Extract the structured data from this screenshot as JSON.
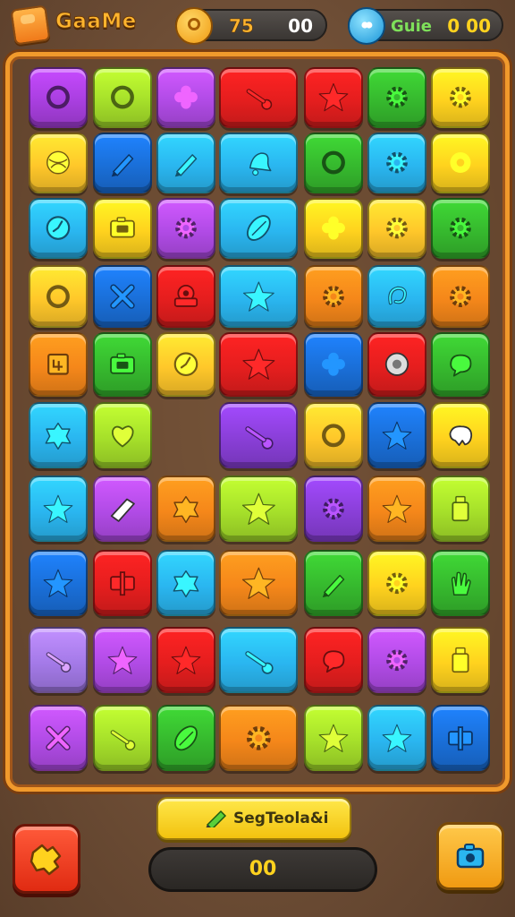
{
  "header": {
    "title": "GaaMe",
    "coin_value": "75",
    "coin_extra": "00",
    "gem_label": "Guie",
    "gem_value": "0 00"
  },
  "board": {
    "rows": [
      [
        {
          "c": "#a93fe0",
          "i": "ring"
        },
        {
          "c": "#a6e02a",
          "i": "ring"
        },
        {
          "c": "#b14be6",
          "i": "flower"
        },
        {
          "c": "#e51e1e",
          "i": "key",
          "w": 2
        },
        {
          "c": "#e51e1e",
          "i": "star"
        },
        {
          "c": "#36b92e",
          "i": "gear"
        },
        {
          "c": "#ffd21e",
          "i": "gear"
        }
      ],
      [
        {
          "c": "#ffc72a",
          "i": "ball"
        },
        {
          "c": "#1a6fd8",
          "i": "pencil"
        },
        {
          "c": "#2ab6f0",
          "i": "pencil"
        },
        {
          "c": "#2ab6f0",
          "i": "bell",
          "w": 2
        },
        {
          "c": "#36b92e",
          "i": "ring"
        },
        {
          "c": "#2ab6f0",
          "i": "gear"
        },
        {
          "c": "#ffd21e",
          "i": "donut"
        }
      ],
      [
        {
          "c": "#2ab6f0",
          "i": "clock"
        },
        {
          "c": "#ffd21e",
          "i": "camera"
        },
        {
          "c": "#b14be6",
          "i": "gear"
        },
        {
          "c": "#2ab6f0",
          "i": "leaf",
          "w": 2
        },
        {
          "c": "#ffd21e",
          "i": "flower"
        },
        {
          "c": "#ffc72a",
          "i": "gear"
        },
        {
          "c": "#36b92e",
          "i": "gear"
        }
      ],
      [
        {
          "c": "#ffc72a",
          "i": "ring"
        },
        {
          "c": "#1a6fd8",
          "i": "cross"
        },
        {
          "c": "#e51e1e",
          "i": "pot"
        },
        {
          "c": "#2ab6f0",
          "i": "star",
          "w": 2
        },
        {
          "c": "#f5871a",
          "i": "gear"
        },
        {
          "c": "#2ab6f0",
          "i": "hook"
        },
        {
          "c": "#f5871a",
          "i": "gear"
        }
      ],
      [
        {
          "c": "#f5871a",
          "i": "square"
        },
        {
          "c": "#36b92e",
          "i": "camera"
        },
        {
          "c": "#ffc72a",
          "i": "clock"
        },
        {
          "c": "#e51e1e",
          "i": "star",
          "w": 2
        },
        {
          "c": "#1a6fd8",
          "i": "flower"
        },
        {
          "c": "#e51e1e",
          "i": "disc"
        },
        {
          "c": "#36b92e",
          "i": "bubble"
        }
      ],
      [
        {
          "c": "#2ab6f0",
          "i": "blob"
        },
        {
          "c": "#a6e02a",
          "i": "heart"
        },
        {
          "c": null
        },
        {
          "c": "#8a3fd8",
          "i": "key",
          "w": 2
        },
        {
          "c": "#ffc72a",
          "i": "ring"
        },
        {
          "c": "#1a6fd8",
          "i": "star"
        },
        {
          "c": "#ffd21e",
          "i": "tooth"
        }
      ],
      [
        {
          "c": "#2ab6f0",
          "i": "star"
        },
        {
          "c": "#b14be6",
          "i": "scroll"
        },
        {
          "c": "#f5871a",
          "i": "blob"
        },
        {
          "c": "#a6e02a",
          "i": "star",
          "w": 2
        },
        {
          "c": "#8a3fd8",
          "i": "gear"
        },
        {
          "c": "#f5871a",
          "i": "star"
        },
        {
          "c": "#a6e02a",
          "i": "cup"
        }
      ],
      [
        {
          "c": "#1a6fd8",
          "i": "star"
        },
        {
          "c": "#e51e1e",
          "i": "sign"
        },
        {
          "c": "#2ab6f0",
          "i": "blob"
        },
        {
          "c": "#f5871a",
          "i": "star",
          "w": 2
        },
        {
          "c": "#36b92e",
          "i": "pencil"
        },
        {
          "c": "#ffd21e",
          "i": "gear"
        },
        {
          "c": "#36b92e",
          "i": "hand"
        }
      ],
      [
        {
          "c": "#a47ae8",
          "i": "key"
        },
        {
          "c": "#b14be6",
          "i": "star"
        },
        {
          "c": "#e51e1e",
          "i": "star"
        },
        {
          "c": "#2ab6f0",
          "i": "key",
          "w": 2
        },
        {
          "c": "#e51e1e",
          "i": "bubble"
        },
        {
          "c": "#b14be6",
          "i": "gear"
        },
        {
          "c": "#ffd21e",
          "i": "cup"
        }
      ],
      [
        {
          "c": "#b14be6",
          "i": "cross"
        },
        {
          "c": "#a6e02a",
          "i": "key"
        },
        {
          "c": "#36b92e",
          "i": "leaf"
        },
        {
          "c": "#f5871a",
          "i": "gear",
          "w": 2
        },
        {
          "c": "#a6e02a",
          "i": "star"
        },
        {
          "c": "#2ab6f0",
          "i": "star"
        },
        {
          "c": "#1a6fd8",
          "i": "sign"
        }
      ]
    ]
  },
  "footer": {
    "label": "SegTeola&i",
    "score": "00"
  }
}
